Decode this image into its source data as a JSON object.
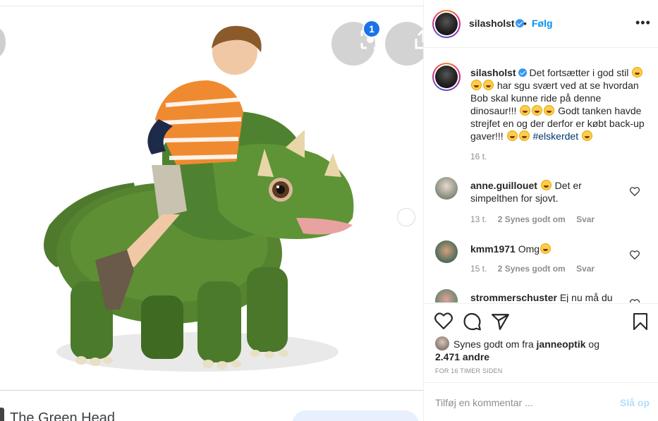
{
  "media": {
    "lens_badge": "1",
    "source_title": "The Green Head"
  },
  "post": {
    "username": "silasholst",
    "follow_label": "Følg",
    "dot": "•",
    "more_label": "•••",
    "caption_part1": "Det fortsætter i god stil",
    "caption_part2": "har sgu svært ved at se hvordan Bob skal kunne ride på denne dinosaur!!!",
    "caption_part3": "Godt tanken havde strejfet en og der derfor er købt back-up gaver!!!",
    "hashtag": "#elskerdet",
    "caption_time": "16 t."
  },
  "comments": [
    {
      "username": "anne.guillouet",
      "text": "Det er simpelthen for sjovt.",
      "time": "13 t.",
      "likes": "2 Synes godt om",
      "reply": "Svar"
    },
    {
      "username": "kmm1971",
      "text": "Omg",
      "time": "15 t.",
      "likes": "2 Synes godt om",
      "reply": "Svar"
    },
    {
      "username": "strommerschuster",
      "text": "Ej nu må du"
    }
  ],
  "likes": {
    "prefix": "Synes godt om fra",
    "by_user": "janneoptik",
    "connector": "og",
    "count": "2.471 andre"
  },
  "timestamp": "FOR 16 TIMER SIDEN",
  "add_comment": {
    "placeholder": "Tilføj en kommentar ...",
    "post_label": "Slå op"
  }
}
